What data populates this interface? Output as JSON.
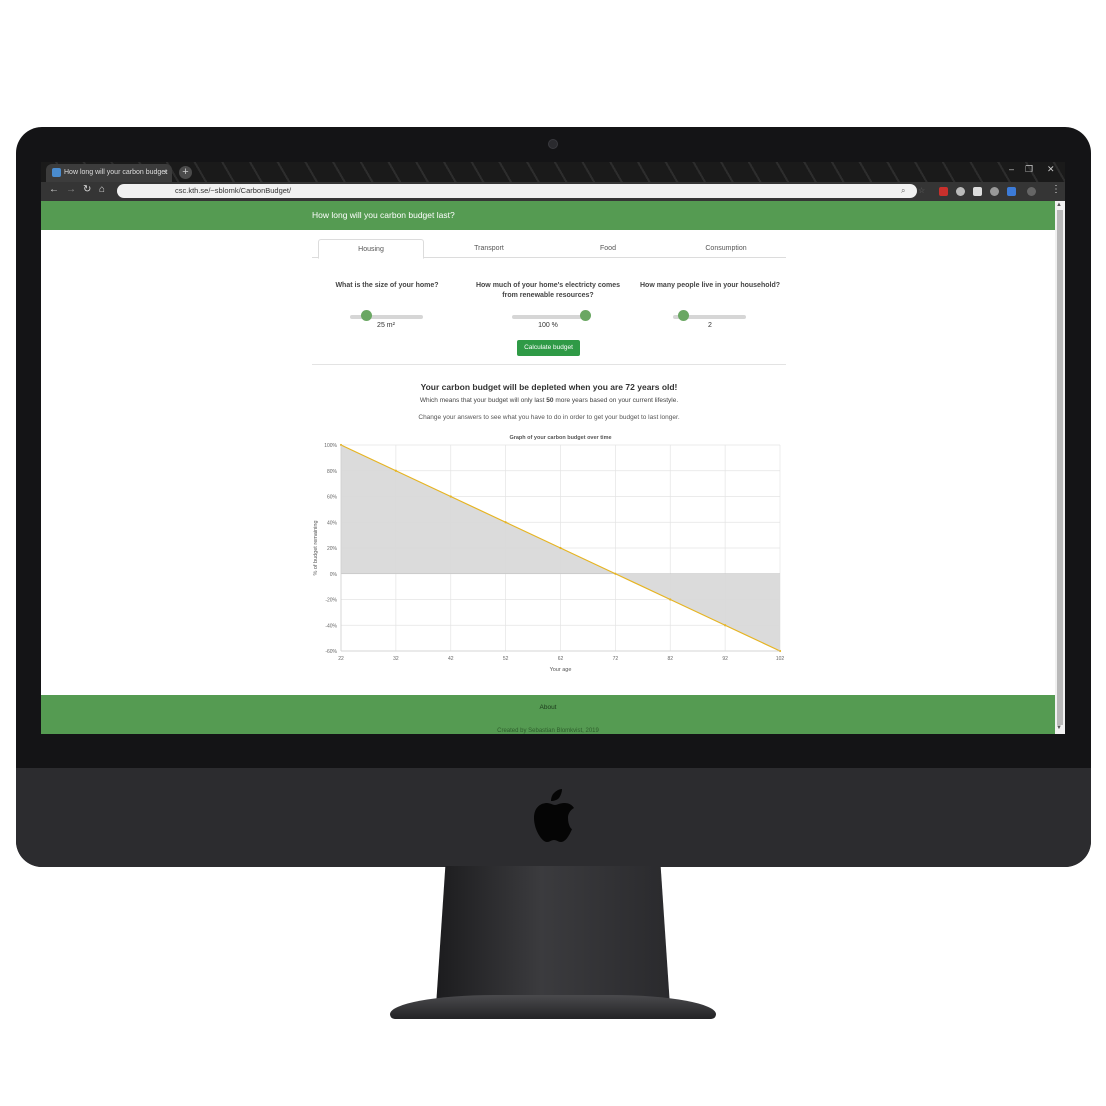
{
  "browser": {
    "tab_title": "How long will your carbon budget",
    "tab_close": "×",
    "new_tab": "+",
    "url": "csc.kth.se/~sblomk/CarbonBudget/"
  },
  "page": {
    "header_title": "How long will you carbon budget last?",
    "tabs": [
      {
        "label": "Housing",
        "active": true
      },
      {
        "label": "Transport",
        "active": false
      },
      {
        "label": "Food",
        "active": false
      },
      {
        "label": "Consumption",
        "active": false
      }
    ],
    "questions": [
      {
        "label": "What is the size of your home?",
        "value": "25 m²",
        "fill": 0.22
      },
      {
        "label": "How much of your home's electricty comes from renewable resources?",
        "value": "100 %",
        "fill": 1.0
      },
      {
        "label": "How many people live in your household?",
        "value": "2",
        "fill": 0.15
      }
    ],
    "calculate_button": "Calculate budget",
    "result": {
      "main_prefix": "Your carbon budget will be depleted when you are ",
      "age": "72",
      "main_suffix": " years old!",
      "sub_prefix": "Which means that your budget will only last ",
      "years": "50",
      "sub_suffix": " more years based on your current lifestyle.",
      "hint": "Change your answers to see what you have to do in order to get your budget to last longer."
    },
    "footer": {
      "about": "About",
      "credit": "Created by Sebastian Blomkvist, 2019"
    }
  },
  "colors": {
    "header_green": "#559b52",
    "button_green": "#2f9a46",
    "line": "#e6b422",
    "fill": "#d9d9d9"
  },
  "chart_data": {
    "type": "area",
    "title": "Graph of your carbon budget over time",
    "xlabel": "Your age",
    "ylabel": "% of budget remaining",
    "x": [
      22,
      32,
      42,
      52,
      62,
      72,
      82,
      92,
      102
    ],
    "values": [
      100,
      80,
      60,
      40,
      20,
      0,
      -20,
      -40,
      -60
    ],
    "xlim": [
      22,
      102
    ],
    "ylim": [
      -60,
      100
    ],
    "yticks": [
      "100%",
      "80%",
      "60%",
      "40%",
      "20%",
      "0%",
      "-20%",
      "-40%",
      "-60%"
    ],
    "xticks": [
      "22",
      "32",
      "42",
      "52",
      "62",
      "72",
      "82",
      "92",
      "102"
    ],
    "grid": true
  }
}
